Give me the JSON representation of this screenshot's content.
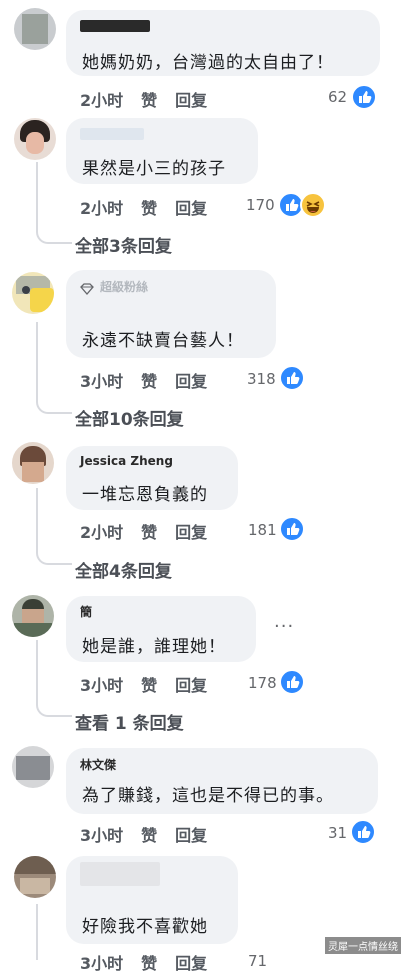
{
  "comments": [
    {
      "text": "她媽奶奶，台灣過的太自由了！",
      "time": "2小时",
      "like": "赞",
      "reply": "回复",
      "count": "62",
      "replies": ""
    },
    {
      "text": "果然是小三的孩子",
      "time": "2小时",
      "like": "赞",
      "reply": "回复",
      "count": "170",
      "replies": "全部3条回复"
    },
    {
      "name": "超級粉絲",
      "text": "永遠不缺賣台藝人！",
      "time": "3小时",
      "like": "赞",
      "reply": "回复",
      "count": "318",
      "replies": "全部10条回复"
    },
    {
      "name": "Jessica Zheng",
      "text": "一堆忘恩負義的",
      "time": "2小时",
      "like": "赞",
      "reply": "回复",
      "count": "181",
      "replies": "全部4条回复"
    },
    {
      "name": "簡",
      "text": "她是誰，誰理她！",
      "time": "3小时",
      "like": "赞",
      "reply": "回复",
      "count": "178",
      "replies": "查看 1 条回复"
    },
    {
      "name": "林文傑",
      "text": "為了賺錢，這也是不得已的事。",
      "time": "3小时",
      "like": "赞",
      "reply": "回复",
      "count": "31",
      "replies": ""
    },
    {
      "text": "好險我不喜歡她",
      "time": "3小时",
      "like": "赞",
      "reply": "回复",
      "count": "71",
      "replies": ""
    }
  ],
  "more": "···",
  "watermark": "灵犀一点情丝绕",
  "colors": {
    "like": "#2e89ff",
    "bubble": "#f0f2f5",
    "thread_line": "#d8dadf"
  }
}
